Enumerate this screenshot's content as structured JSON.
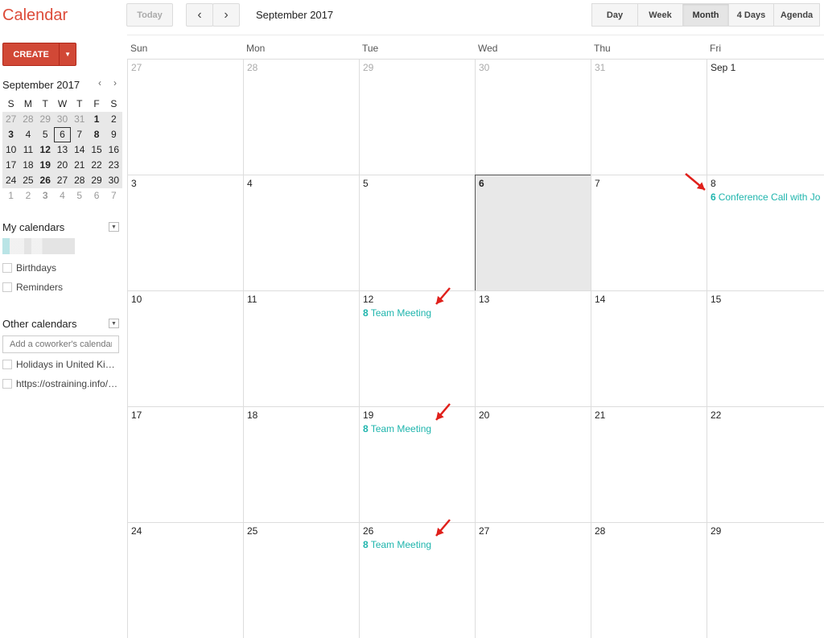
{
  "app": {
    "title": "Calendar"
  },
  "toolbar": {
    "today": "Today",
    "prev": "‹",
    "next": "›",
    "current": "September 2017",
    "views": [
      {
        "label": "Day",
        "w": 58
      },
      {
        "label": "Week",
        "w": 57
      },
      {
        "label": "Month",
        "w": 58,
        "selected": true
      },
      {
        "label": "4 Days",
        "w": 57
      },
      {
        "label": "Agenda",
        "w": 58
      }
    ]
  },
  "sidebar": {
    "create": "CREATE",
    "create_menu": "▼",
    "mini": {
      "title": "September 2017",
      "prev": "‹",
      "next": "›",
      "dow": [
        "S",
        "M",
        "T",
        "W",
        "T",
        "F",
        "S"
      ],
      "weeks": [
        [
          "27",
          "28",
          "29",
          "30",
          "31",
          "1",
          "2"
        ],
        [
          "3",
          "4",
          "5",
          "6",
          "7",
          "8",
          "9"
        ],
        [
          "10",
          "11",
          "12",
          "13",
          "14",
          "15",
          "16"
        ],
        [
          "17",
          "18",
          "19",
          "20",
          "21",
          "22",
          "23"
        ],
        [
          "24",
          "25",
          "26",
          "27",
          "28",
          "29",
          "30"
        ],
        [
          "1",
          "2",
          "3",
          "4",
          "5",
          "6",
          "7"
        ]
      ],
      "today": "6",
      "bold": [
        "1",
        "8",
        "12",
        "19",
        "26",
        "3"
      ]
    },
    "my_calendars": {
      "label": "My calendars",
      "items": [
        "Birthdays",
        "Reminders"
      ]
    },
    "other_calendars": {
      "label": "Other calendars",
      "placeholder": "Add a coworker's calendar",
      "items": [
        "Holidays in United Ki…",
        "https://ostraining.info/…"
      ]
    }
  },
  "month": {
    "dow": [
      "Sun",
      "Mon",
      "Tue",
      "Wed",
      "Thu",
      "Fri"
    ],
    "weeks": [
      [
        {
          "d": "27",
          "m": true
        },
        {
          "d": "28",
          "m": true
        },
        {
          "d": "29",
          "m": true
        },
        {
          "d": "30",
          "m": true
        },
        {
          "d": "31",
          "m": true
        },
        {
          "d": "Sep 1"
        }
      ],
      [
        {
          "d": "3"
        },
        {
          "d": "4"
        },
        {
          "d": "5"
        },
        {
          "d": "6",
          "today": true
        },
        {
          "d": "7"
        },
        {
          "d": "8",
          "ev": {
            "time": "6",
            "title": "Conference Call with John"
          },
          "arrow": true
        }
      ],
      [
        {
          "d": "10"
        },
        {
          "d": "11"
        },
        {
          "d": "12",
          "ev": {
            "time": "8",
            "title": "Team Meeting"
          },
          "arrow": true
        },
        {
          "d": "13"
        },
        {
          "d": "14"
        },
        {
          "d": "15"
        }
      ],
      [
        {
          "d": "17"
        },
        {
          "d": "18"
        },
        {
          "d": "19",
          "ev": {
            "time": "8",
            "title": "Team Meeting"
          },
          "arrow": true
        },
        {
          "d": "20"
        },
        {
          "d": "21"
        },
        {
          "d": "22"
        }
      ],
      [
        {
          "d": "24"
        },
        {
          "d": "25"
        },
        {
          "d": "26",
          "ev": {
            "time": "8",
            "title": "Team Meeting"
          },
          "arrow": true
        },
        {
          "d": "27"
        },
        {
          "d": "28"
        },
        {
          "d": "29"
        }
      ]
    ]
  },
  "colors": {
    "accent": "#dd4b39",
    "event": "#1fb5ad",
    "arrow": "#e0201b"
  }
}
